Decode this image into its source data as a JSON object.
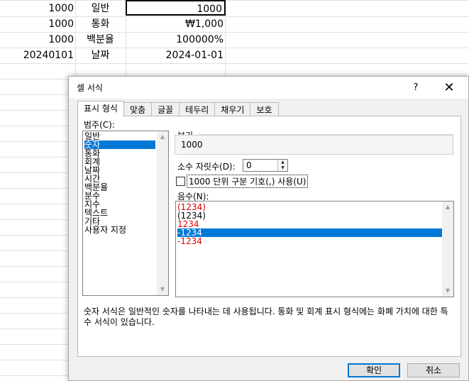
{
  "sheet": {
    "rows": [
      {
        "value": "1000",
        "type": "일반",
        "formatted": "1000"
      },
      {
        "value": "1000",
        "type": "통화",
        "formatted": "₩1,000"
      },
      {
        "value": "1000",
        "type": "백분율",
        "formatted": "100000%"
      },
      {
        "value": "20240101",
        "type": "날짜",
        "formatted": "2024-01-01"
      }
    ]
  },
  "dialog": {
    "title": "셀 서식",
    "help": "?",
    "close": "✕",
    "tabs": [
      "표시 형식",
      "맞춤",
      "글꼴",
      "테두리",
      "채우기",
      "보호"
    ],
    "category_label": "범주(C):",
    "categories": [
      "일반",
      "숫자",
      "통화",
      "회계",
      "날짜",
      "시간",
      "백분율",
      "분수",
      "지수",
      "텍스트",
      "기타",
      "사용자 지정"
    ],
    "selected_category": "숫자",
    "preview_label": "보기",
    "preview_value": "1000",
    "decimal_label": "소수 자릿수(D):",
    "decimal_value": "0",
    "separator_label": "1000 단위 구분 기호(,) 사용(U)",
    "negative_label": "음수(N):",
    "negative_options": [
      "(1234)",
      "(1234)",
      "1234",
      "-1234",
      "-1234"
    ],
    "description": "숫자 서식은 일반적인 숫자를 나타내는 데 사용됩니다. 통화 및 회계 표시 형식에는 화폐 가치에 대한 특수 서식이 있습니다.",
    "ok_label": "확인",
    "cancel_label": "취소",
    "colors": {
      "selection": "#0078d7",
      "negative_red": "#e00000"
    }
  }
}
